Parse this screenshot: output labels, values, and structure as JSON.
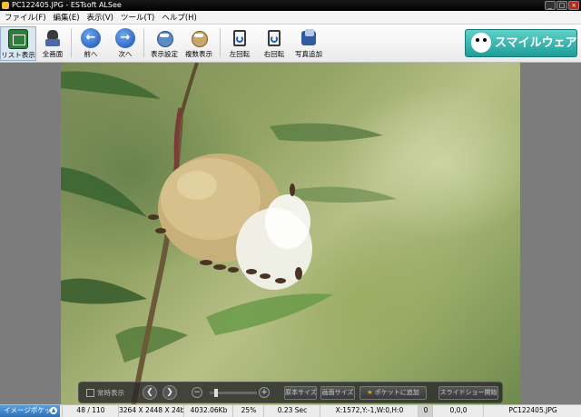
{
  "window": {
    "title": "PC122405.JPG - ESTsoft ALSee",
    "controls": [
      "_",
      "□",
      "×"
    ]
  },
  "menu": [
    {
      "label": "ファイル(F)"
    },
    {
      "label": "編集(E)"
    },
    {
      "label": "表示(V)"
    },
    {
      "label": "ツール(T)"
    },
    {
      "label": "ヘルプ(H)"
    }
  ],
  "toolbar": {
    "list_view": "リスト表示",
    "fullscreen": "全画面",
    "prev": "前へ",
    "next": "次へ",
    "view_settings": "表示設定",
    "thumbnail_view": "複数表示",
    "rotate_left": "左回転",
    "rotate_right": "右回転",
    "add_photo": "写真追加",
    "brand": "スマイルウェア"
  },
  "controlbar": {
    "fixed_display": "常時表示",
    "zoom_level": 0.1,
    "original_size": "原本サイズ",
    "fit_screen": "画面サイズ",
    "add_to_pocket": "ポケットに追加",
    "slideshow": "スライドショー開始"
  },
  "statusbar": {
    "image_pocket": "イメージポケット",
    "position": "48 / 110",
    "dimensions": "3264 X 2448 X 24b",
    "filesize": "4032.06Kb",
    "zoom": "25%",
    "load_time": "0.23 Sec",
    "coords": "X:1572,Y:-1,W:0,H:0",
    "color_index": "0",
    "color_value": "0,0,0",
    "filename": "PC122405.JPG"
  },
  "colors": {
    "accent": "#2f70b8",
    "brand": "#1f9e98",
    "titlebar": "#000000"
  }
}
